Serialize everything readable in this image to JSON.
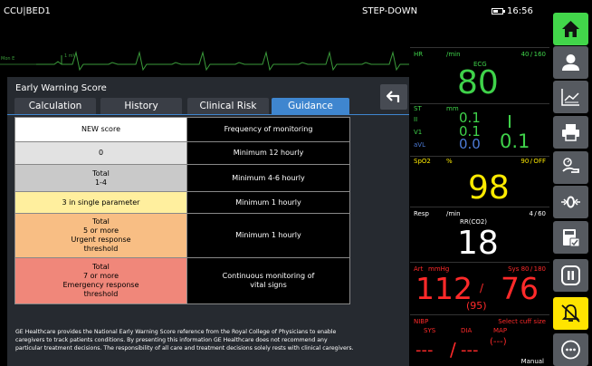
{
  "topbar": {
    "bed": "CCU|BED1",
    "mode": "STEP-DOWN",
    "clock": "16:56"
  },
  "ecg_strip": {
    "scale": "1 mV",
    "left_label": "Mon E",
    "color": "#3a9a3a"
  },
  "ews": {
    "title": "Early Warning Score",
    "tabs": [
      "Calculation",
      "History",
      "Clinical Risk",
      "Guidance"
    ],
    "active_tab": "Guidance",
    "headers": [
      "NEW score",
      "Frequency of monitoring"
    ],
    "rows": [
      {
        "score": [
          "0"
        ],
        "frequency": [
          "Minimum 12 hourly"
        ]
      },
      {
        "score": [
          "Total",
          "1-4"
        ],
        "frequency": [
          "Minimum 4-6 hourly"
        ]
      },
      {
        "score": [
          "3 in single parameter"
        ],
        "frequency": [
          "Minimum 1 hourly"
        ]
      },
      {
        "score": [
          "Total",
          "5 or more",
          "Urgent response",
          "threshold"
        ],
        "frequency": [
          "Minimum 1 hourly"
        ]
      },
      {
        "score": [
          "Total",
          "7 or more",
          "Emergency response",
          "threshold"
        ],
        "frequency": [
          "Continuous monitoring of",
          "vital signs"
        ]
      }
    ],
    "note": "GE Healthcare provides the National Early Warning Score reference from the Royal College of Physicians to enable caregivers to track patients conditions. By presenting this information GE Healthcare does not recommend any particular treatment decisions. The responsibility of all care and treatment decisions solely rests with clinical caregivers."
  },
  "vitals": {
    "hr": {
      "label": "HR",
      "unit": "/min",
      "limits": "40 / 160",
      "source": "ECG",
      "value": "80",
      "color": "#3fd24a"
    },
    "st": {
      "label": "ST",
      "unit": "mm",
      "leads": [
        "II",
        "V1",
        "aVL"
      ],
      "values": [
        "0.1",
        "0.1",
        "0.0"
      ],
      "big_value": "0.1",
      "color": "#3fd24a",
      "avl_color": "#4d7bd6"
    },
    "spo2": {
      "label": "SpO2",
      "unit": "%",
      "limits": "90 / OFF",
      "value": "98",
      "color": "#ffeb00"
    },
    "resp": {
      "label": "Resp",
      "unit": "/min",
      "limits": "4 / 60",
      "source": "RR(CO2)",
      "value": "18",
      "color": "#ffffff"
    },
    "art": {
      "label": "Art",
      "unit": "mmHg",
      "limits": "Sys 80 / 180",
      "systolic": "112",
      "separator": "/",
      "diastolic": "76",
      "mean": "(95)",
      "color": "#ff2a2a"
    },
    "nibp": {
      "label": "NIBP",
      "status": "Select cuff size",
      "headers": [
        "SYS",
        "DIA",
        "MAP"
      ],
      "systolic": "---",
      "separator": "/",
      "diastolic": "---",
      "mean": "(---)",
      "mode": "Manual",
      "color": "#ff2a2a"
    }
  },
  "sidebar": {
    "buttons": [
      {
        "name": "home",
        "icon": "home-icon"
      },
      {
        "name": "patient",
        "icon": "patient-icon"
      },
      {
        "name": "trends",
        "icon": "trends-icon"
      },
      {
        "name": "print",
        "icon": "printer-icon"
      },
      {
        "name": "measure",
        "icon": "hand-measure-icon"
      },
      {
        "name": "zero",
        "icon": "zero-icon"
      },
      {
        "name": "calculations",
        "icon": "calculator-icon"
      },
      {
        "name": "pause",
        "icon": "pause-icon"
      },
      {
        "name": "alarm",
        "icon": "alarm-silence-icon"
      },
      {
        "name": "more",
        "icon": "more-icon"
      }
    ],
    "home_color": "#42d64a",
    "alarm_color": "#ffe400"
  }
}
